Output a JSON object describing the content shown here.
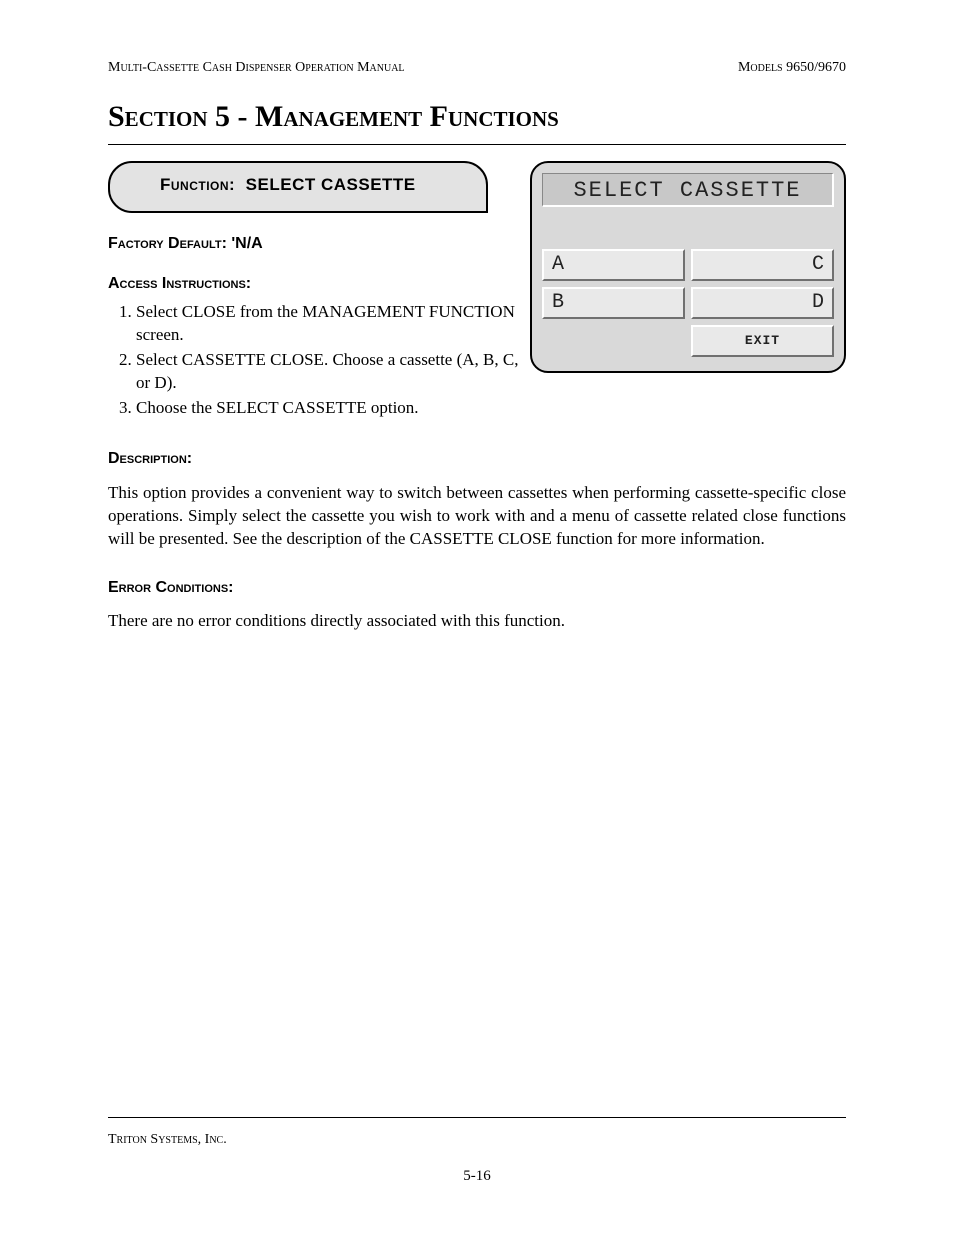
{
  "header": {
    "left": "Multi-Cassette Cash Dispenser Operation Manual",
    "right": "Models 9650/9670"
  },
  "section_title": "Section 5 - Management Functions",
  "function_box": {
    "label": "Function:",
    "name": "SELECT CASSETTE"
  },
  "factory_default": {
    "label": "Factory Default:",
    "value": "'N/A"
  },
  "access": {
    "label": "Access Instructions:",
    "items": [
      "Select CLOSE from the MANAGEMENT FUNCTION screen.",
      "Select CASSETTE CLOSE. Choose a cassette (A, B, C, or D).",
      "Choose the SELECT CASSETTE option."
    ]
  },
  "screen": {
    "title": "SELECT CASSETTE",
    "buttons": {
      "a": "A",
      "b": "B",
      "c": "C",
      "d": "D",
      "exit": "EXIT"
    }
  },
  "description": {
    "label": "Description:",
    "text": "This option provides a convenient way to switch between cassettes when performing cassette-specific close operations. Simply select the cassette you wish to work with and a menu of cassette related close functions will be presented. See the description of the CASSETTE CLOSE function for more information."
  },
  "error": {
    "label": "Error Conditions:",
    "text": "There are no error conditions directly associated with this function."
  },
  "footer": {
    "company": "Triton Systems, Inc.",
    "page": "5-16"
  }
}
